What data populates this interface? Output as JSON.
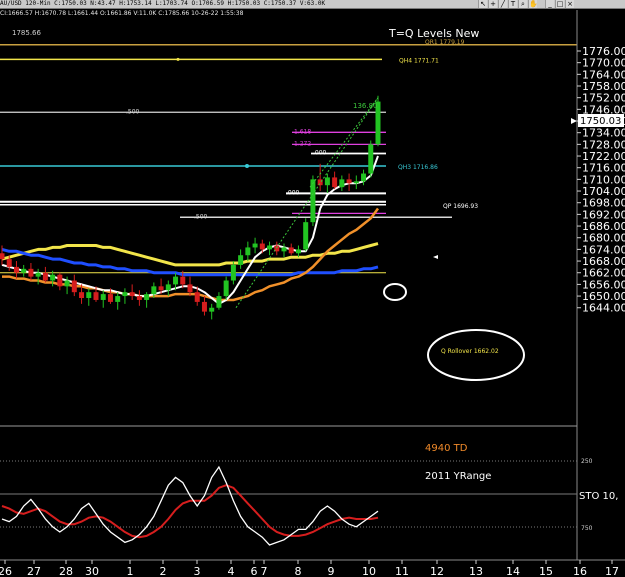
{
  "toolbar": {
    "status_text": "AU/USD 120-Min C:1750.03 N:43.47 H:1753.14 L:1703.74 O:1706.59 H:1750.03 C:1750.37 V:63.0K",
    "status_text2": "CI:1666.57 H:1670.78 L:1661.44 O:1661.86 V:11.0K C:1785.66 10-26-22 1:55:38",
    "tools": [
      "cursor-icon",
      "crosshair-icon",
      "line-icon",
      "text-icon",
      "zoom-icon",
      "hand-icon",
      "close-icon"
    ]
  },
  "chart_data": {
    "type": "candlestick",
    "title": "T=Q Levels New",
    "price_axis": {
      "ticks": [
        "1776.00",
        "1770.00",
        "1764.00",
        "1758.00",
        "1752.00",
        "1746.00",
        "1740.00",
        "1734.00",
        "1728.00",
        "1722.00",
        "1716.00",
        "1710.00",
        "1704.00",
        "1698.00",
        "1692.00",
        "1686.00",
        "1680.00",
        "1674.00",
        "1668.00",
        "1662.00",
        "1656.00",
        "1650.00",
        "1644.00"
      ],
      "ylim": [
        1638,
        1782
      ],
      "current_price": "1750.03"
    },
    "x_axis": {
      "ticks": [
        "26",
        "27",
        "28",
        "30",
        "1",
        "2",
        "3",
        "4",
        "6",
        "7",
        "8",
        "9",
        "10",
        "11",
        "12",
        "13",
        "14",
        "15",
        "16",
        "17"
      ]
    },
    "top_left_label": "1785.66",
    "levels": [
      {
        "label": "QR1 1779.19",
        "value": 1779.19,
        "color": "#c8a040"
      },
      {
        "label": "QH4 1771.71",
        "value": 1771.71,
        "color": "#f2e54a"
      },
      {
        "label": ".500",
        "value": 1744.5,
        "color": "#d8d8d8"
      },
      {
        "label": "1.618",
        "value": 1734.2,
        "color": "#e040e0"
      },
      {
        "label": "1.272",
        "value": 1728.0,
        "color": "#e040e0"
      },
      {
        "label": ".000",
        "value": 1723.3,
        "color": "#ffffff"
      },
      {
        "label": "QH3 1716.86",
        "value": 1716.86,
        "color": "#39c9d6"
      },
      {
        "label": ".000",
        "value": 1702.8,
        "color": "#ffffff"
      },
      {
        "label": "QP 1696.93",
        "value": 1696.93,
        "color": "#ffffff"
      },
      {
        "label": ".500",
        "value": 1690.5,
        "color": "#d8d8d8"
      },
      {
        "label": "Q Rollover 1662.02",
        "value": 1662.02,
        "color": "#f2e54a"
      }
    ],
    "annotations": {
      "peak_label": "136.80",
      "td_label": "4940 TD",
      "yrange_label": "2011 YRange",
      "level_250": "250",
      "level_750": "750",
      "sto_label": "STO 10,"
    },
    "candles": [
      [
        1672,
        1676,
        1666,
        1669
      ],
      [
        1669,
        1671,
        1663,
        1665
      ],
      [
        1665,
        1668,
        1659,
        1662
      ],
      [
        1662,
        1666,
        1660,
        1664
      ],
      [
        1664,
        1667,
        1658,
        1660
      ],
      [
        1660,
        1664,
        1656,
        1662
      ],
      [
        1662,
        1665,
        1657,
        1658
      ],
      [
        1658,
        1663,
        1655,
        1661
      ],
      [
        1661,
        1662,
        1653,
        1655
      ],
      [
        1655,
        1660,
        1651,
        1658
      ],
      [
        1658,
        1661,
        1650,
        1652
      ],
      [
        1652,
        1656,
        1646,
        1649
      ],
      [
        1649,
        1654,
        1645,
        1652
      ],
      [
        1652,
        1655,
        1647,
        1648
      ],
      [
        1648,
        1653,
        1644,
        1651
      ],
      [
        1651,
        1654,
        1646,
        1647
      ],
      [
        1647,
        1652,
        1643,
        1650
      ],
      [
        1650,
        1654,
        1646,
        1652
      ],
      [
        1652,
        1656,
        1648,
        1650
      ],
      [
        1650,
        1653,
        1645,
        1648
      ],
      [
        1648,
        1652,
        1644,
        1651
      ],
      [
        1651,
        1657,
        1649,
        1655
      ],
      [
        1655,
        1659,
        1651,
        1653
      ],
      [
        1653,
        1658,
        1650,
        1656
      ],
      [
        1656,
        1662,
        1653,
        1660
      ],
      [
        1660,
        1663,
        1654,
        1656
      ],
      [
        1656,
        1660,
        1650,
        1652
      ],
      [
        1652,
        1655,
        1645,
        1647
      ],
      [
        1647,
        1650,
        1640,
        1642
      ],
      [
        1642,
        1646,
        1638,
        1644
      ],
      [
        1644,
        1652,
        1643,
        1650
      ],
      [
        1650,
        1660,
        1648,
        1658
      ],
      [
        1658,
        1668,
        1656,
        1666
      ],
      [
        1666,
        1674,
        1664,
        1671
      ],
      [
        1671,
        1678,
        1668,
        1675
      ],
      [
        1675,
        1680,
        1672,
        1677
      ],
      [
        1677,
        1679,
        1672,
        1674
      ],
      [
        1674,
        1678,
        1671,
        1676
      ],
      [
        1676,
        1678,
        1671,
        1673
      ],
      [
        1673,
        1677,
        1670,
        1675
      ],
      [
        1675,
        1677,
        1671,
        1672
      ],
      [
        1672,
        1676,
        1670,
        1674
      ],
      [
        1674,
        1690,
        1673,
        1688
      ],
      [
        1688,
        1712,
        1686,
        1710
      ],
      [
        1710,
        1718,
        1704,
        1707
      ],
      [
        1707,
        1713,
        1703,
        1711
      ],
      [
        1711,
        1714,
        1705,
        1706
      ],
      [
        1706,
        1712,
        1704,
        1710
      ],
      [
        1710,
        1713,
        1704,
        1708
      ],
      [
        1708,
        1712,
        1705,
        1709
      ],
      [
        1709,
        1715,
        1707,
        1713
      ],
      [
        1713,
        1730,
        1711,
        1728
      ],
      [
        1728,
        1753,
        1727,
        1750
      ]
    ],
    "bands": [
      {
        "name": "yellow",
        "color": "#f2e54a",
        "values": [
          1669,
          1670,
          1671,
          1672,
          1673,
          1674,
          1674,
          1675,
          1675,
          1676,
          1676,
          1676,
          1676,
          1676,
          1675,
          1675,
          1674,
          1673,
          1672,
          1671,
          1670,
          1669,
          1668,
          1667,
          1666,
          1666,
          1666,
          1666,
          1666,
          1666,
          1666,
          1667,
          1667,
          1667,
          1668,
          1668,
          1668,
          1669,
          1669,
          1669,
          1670,
          1670,
          1670,
          1671,
          1671,
          1672,
          1672,
          1673,
          1673,
          1674,
          1675,
          1676,
          1677
        ]
      },
      {
        "name": "blue",
        "color": "#1f4fff",
        "values": [
          1674,
          1673,
          1673,
          1672,
          1671,
          1671,
          1670,
          1669,
          1669,
          1668,
          1667,
          1667,
          1666,
          1666,
          1665,
          1665,
          1664,
          1664,
          1663,
          1663,
          1663,
          1662,
          1662,
          1662,
          1662,
          1661,
          1661,
          1661,
          1661,
          1661,
          1661,
          1661,
          1661,
          1661,
          1661,
          1661,
          1661,
          1661,
          1661,
          1661,
          1661,
          1662,
          1662,
          1662,
          1662,
          1662,
          1662,
          1663,
          1663,
          1663,
          1664,
          1664,
          1665
        ]
      },
      {
        "name": "orange",
        "color": "#f0902a",
        "values": [
          1660,
          1660,
          1659,
          1659,
          1658,
          1658,
          1657,
          1657,
          1656,
          1656,
          1655,
          1655,
          1654,
          1654,
          1653,
          1652,
          1652,
          1651,
          1651,
          1650,
          1650,
          1650,
          1650,
          1650,
          1651,
          1651,
          1651,
          1651,
          1650,
          1649,
          1648,
          1648,
          1648,
          1649,
          1650,
          1652,
          1653,
          1655,
          1656,
          1657,
          1659,
          1660,
          1662,
          1665,
          1669,
          1673,
          1676,
          1679,
          1682,
          1684,
          1687,
          1690,
          1695
        ]
      },
      {
        "name": "white",
        "color": "#ffffff",
        "values": [
          1666,
          1665,
          1664,
          1663,
          1662,
          1662,
          1661,
          1660,
          1659,
          1658,
          1657,
          1656,
          1655,
          1654,
          1653,
          1653,
          1652,
          1651,
          1651,
          1650,
          1650,
          1651,
          1652,
          1653,
          1654,
          1655,
          1655,
          1654,
          1652,
          1649,
          1646,
          1648,
          1652,
          1658,
          1664,
          1670,
          1673,
          1675,
          1676,
          1675,
          1674,
          1673,
          1673,
          1680,
          1695,
          1702,
          1705,
          1707,
          1708,
          1708,
          1709,
          1712,
          1722
        ]
      }
    ],
    "stochastic": {
      "ylim": [
        0,
        1000
      ],
      "fast": [
        700,
        720,
        680,
        600,
        550,
        620,
        700,
        760,
        800,
        760,
        700,
        620,
        580,
        660,
        740,
        800,
        840,
        880,
        860,
        820,
        760,
        680,
        560,
        440,
        380,
        420,
        520,
        600,
        520,
        380,
        300,
        420,
        560,
        680,
        760,
        800,
        840,
        900,
        880,
        860,
        820,
        780,
        780,
        720,
        640,
        600,
        640,
        700,
        740,
        760,
        720,
        680,
        640
      ],
      "slow": [
        600,
        620,
        650,
        660,
        640,
        620,
        640,
        680,
        720,
        740,
        740,
        720,
        690,
        680,
        690,
        720,
        760,
        800,
        830,
        840,
        830,
        800,
        760,
        700,
        630,
        580,
        560,
        560,
        560,
        520,
        460,
        440,
        460,
        520,
        580,
        640,
        700,
        760,
        800,
        820,
        830,
        830,
        820,
        800,
        770,
        740,
        720,
        700,
        690,
        700,
        700,
        700,
        690
      ]
    }
  }
}
